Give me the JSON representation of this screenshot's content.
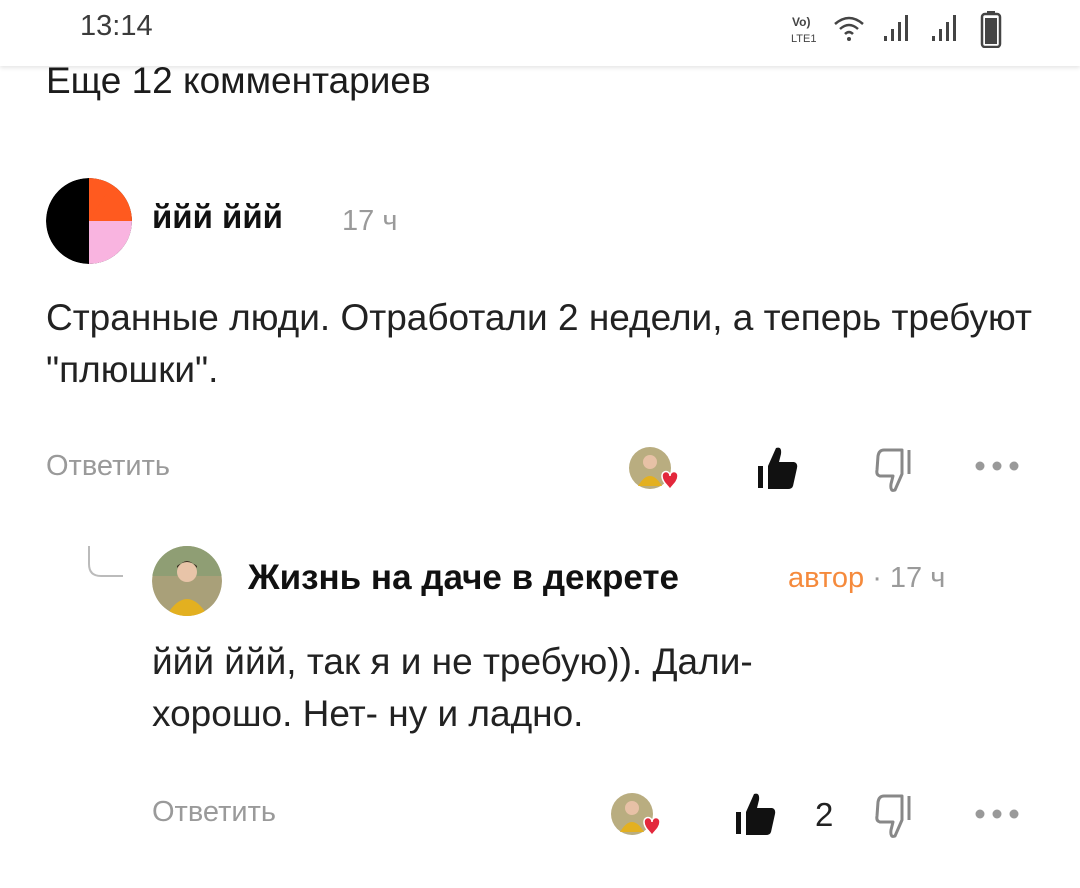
{
  "status_bar": {
    "time": "13:14",
    "icons": [
      "volte-icon",
      "wifi-icon",
      "signal-icon",
      "signal-icon",
      "battery-icon"
    ]
  },
  "thread": {
    "more_comments_label": "Еще 12 комментариев",
    "comment": {
      "author": "ййй ййй",
      "time": "17 ч",
      "text": "Странные люди. Отработали 2 недели, а теперь требуют \"плюшки\".",
      "reply_label": "Ответить",
      "like_count": ""
    },
    "reply": {
      "author": "Жизнь на даче в декрете",
      "author_badge": "автор",
      "separator": "·",
      "time": "17 ч",
      "text": "ййй ййй, так я и не требую)). Дали- хорошо. Нет- ну и ладно.",
      "reply_label": "Ответить",
      "like_count": "2"
    }
  },
  "colors": {
    "accent": "#f58a3c",
    "muted_text": "#9a9a9a",
    "heart": "#e3283c",
    "avatar_orange": "#ff5a1f",
    "avatar_pink": "#f9b4e0"
  }
}
